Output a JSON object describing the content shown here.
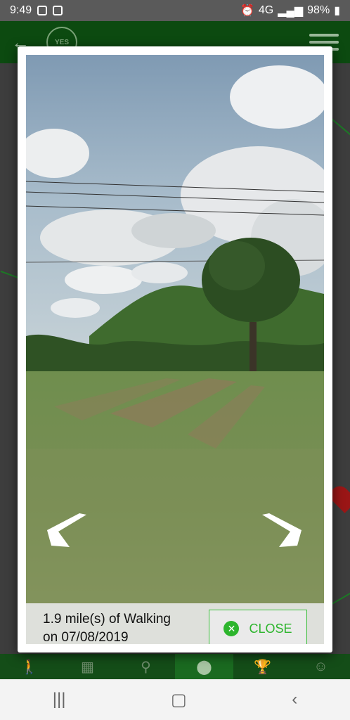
{
  "status_bar": {
    "time": "9:49",
    "network": "4G",
    "battery": "98%"
  },
  "header": {
    "back_icon": "arrow-left-icon",
    "logo_text": "YES"
  },
  "modal": {
    "caption": "1.9 mile(s) of Walking on 07/08/2019",
    "close_label": "CLOSE",
    "prev_icon": "chevron-left-icon",
    "next_icon": "chevron-right-icon"
  },
  "colors": {
    "accent": "#2db52d",
    "header": "#0c4a10"
  }
}
